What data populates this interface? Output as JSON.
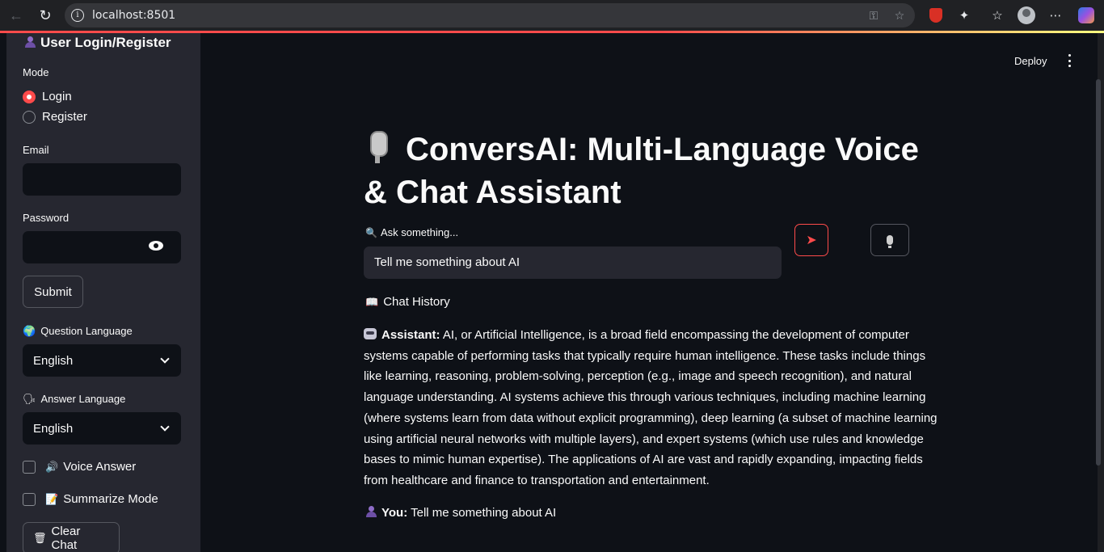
{
  "browser": {
    "url": "localhost:8501"
  },
  "sidebar": {
    "title": "User Login/Register",
    "mode_label": "Mode",
    "mode_options": [
      "Login",
      "Register"
    ],
    "mode_selected": "Login",
    "email_label": "Email",
    "email_value": "",
    "password_label": "Password",
    "password_value": "",
    "submit_label": "Submit",
    "question_language_label": "Question Language",
    "question_language_value": "English",
    "answer_language_label": "Answer Language",
    "answer_language_value": "English",
    "voice_answer_label": "Voice Answer",
    "voice_answer_checked": false,
    "summarize_mode_label": "Summarize Mode",
    "summarize_mode_checked": false,
    "clear_chat_label": "Clear Chat"
  },
  "header": {
    "deploy_label": "Deploy"
  },
  "main": {
    "title": "ConversAI: Multi-Language Voice & Chat Assistant",
    "ask_label": "Ask something...",
    "ask_value": "Tell me something about AI",
    "send_icon": "➤",
    "chat_history_label": "Chat History",
    "messages": [
      {
        "role_label": "Assistant:",
        "text": "AI, or Artificial Intelligence, is a broad field encompassing the development of computer systems capable of performing tasks that typically require human intelligence. These tasks include things like learning, reasoning, problem-solving, perception (e.g., image and speech recognition), and natural language understanding. AI systems achieve this through various techniques, including machine learning (where systems learn from data without explicit programming), deep learning (a subset of machine learning using artificial neural networks with multiple layers), and expert systems (which use rules and knowledge bases to mimic human expertise). The applications of AI are vast and rapidly expanding, impacting fields from healthcare and finance to transportation and entertainment."
      },
      {
        "role_label": "You:",
        "text": "Tell me something about AI"
      }
    ]
  },
  "colors": {
    "accent": "#ff4b4b",
    "background": "#0e1117",
    "sidebar": "#262730"
  }
}
